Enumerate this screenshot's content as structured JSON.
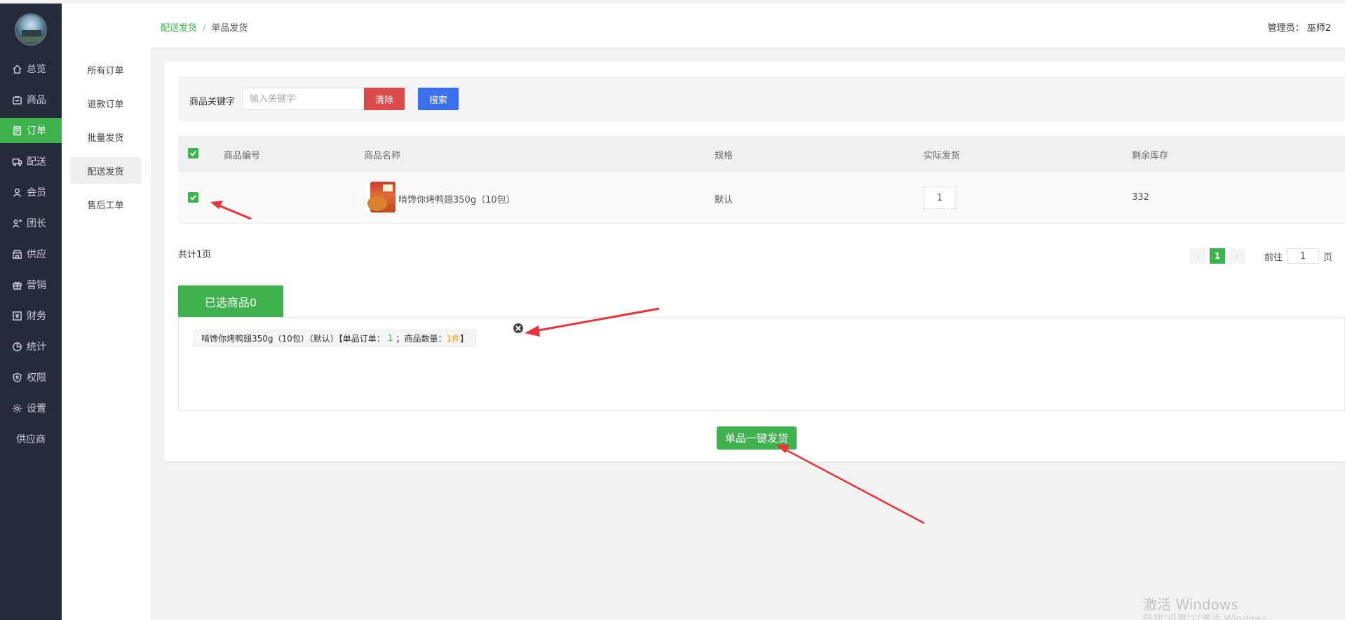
{
  "nav": {
    "items": [
      {
        "label": "总览",
        "icon": "home-icon"
      },
      {
        "label": "商品",
        "icon": "goods-icon"
      },
      {
        "label": "订单",
        "icon": "order-icon",
        "active": true
      },
      {
        "label": "配送",
        "icon": "delivery-icon"
      },
      {
        "label": "会员",
        "icon": "user-icon"
      },
      {
        "label": "团长",
        "icon": "leader-icon"
      },
      {
        "label": "供应",
        "icon": "supply-icon"
      },
      {
        "label": "营销",
        "icon": "gift-icon"
      },
      {
        "label": "财务",
        "icon": "finance-icon"
      },
      {
        "label": "统计",
        "icon": "chart-icon"
      },
      {
        "label": "权限",
        "icon": "shield-icon"
      },
      {
        "label": "设置",
        "icon": "gear-icon"
      },
      {
        "label": "供应商",
        "icon": ""
      }
    ]
  },
  "submenu": {
    "items": [
      "所有订单",
      "退款订单",
      "批量发货",
      "配送发货",
      "售后工单"
    ],
    "active_index": 3
  },
  "header": {
    "breadcrumb_parent": "配送发货",
    "breadcrumb_sep": "/",
    "breadcrumb_current": "单品发货",
    "admin": "管理员：   巫师2"
  },
  "search": {
    "label": "商品关键字",
    "placeholder": "输入关键字",
    "clear_label": "清除",
    "search_label": "搜索"
  },
  "table": {
    "headers": {
      "code": "商品编号",
      "name": "商品名称",
      "spec": "规格",
      "ship": "实际发货",
      "stock": "剩余库存"
    },
    "rows": [
      {
        "code": "",
        "name": "啃馋你烤鸭翅350g（10包）",
        "spec": "默认",
        "ship": "1",
        "stock": "332",
        "checked": true
      }
    ]
  },
  "pagination": {
    "total_text": "共计1页",
    "prev": "‹",
    "current": "1",
    "next": "›",
    "goto_label": "前往",
    "goto_value": "1",
    "page_suffix": "页"
  },
  "selected": {
    "tab_label": "已选商品0",
    "tag": {
      "prefix": "啃馋你烤鸭翅350g（10包）（默认）【单品订单：",
      "order_count": "1",
      "mid": "；商品数量：",
      "qty": "1件",
      "suffix": "】"
    }
  },
  "actions": {
    "ship_label": "单品一键发货"
  },
  "watermark": {
    "line1": "激活 Windows",
    "line2": "转到\"设置\"以激活 Windows。"
  },
  "colors": {
    "accent": "#3eb34d",
    "danger": "#dc4b4b",
    "primary": "#3a6ff0",
    "nav_bg": "#262b3c",
    "annotation": "#e8333a"
  }
}
